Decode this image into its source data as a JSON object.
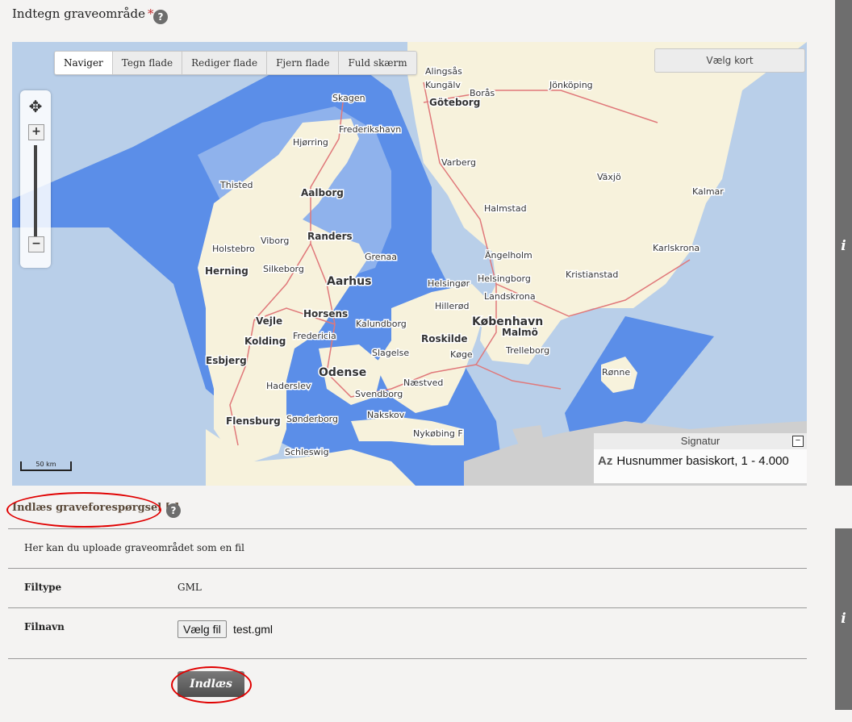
{
  "header": {
    "title": "Indtegn graveområde",
    "required_mark": "*",
    "help_glyph": "?"
  },
  "map": {
    "tabs": [
      "Naviger",
      "Tegn flade",
      "Rediger flade",
      "Fjern flade",
      "Fuld skærm"
    ],
    "active_tab": "Naviger",
    "choose_map_label": "Vælg kort",
    "zoom_in": "+",
    "zoom_out": "−",
    "scale_label": "50 km",
    "legend": {
      "title": "Signatur",
      "collapse": "−",
      "icon_text": "Az",
      "entry": "Husnummer basiskort, 1 - 4.000"
    },
    "places": [
      "Alingsås",
      "Kungälv",
      "Jönköping",
      "Göteborg",
      "Borås",
      "Skagen",
      "Frederikshavn",
      "Hjørring",
      "Varberg",
      "Växjö",
      "Kalmar",
      "Thisted",
      "Aalborg",
      "Halmstad",
      "Randers",
      "Viborg",
      "Holstebro",
      "Grenaa",
      "Karlskrona",
      "Ängelholm",
      "Herning",
      "Silkeborg",
      "Kristianstad",
      "Helsingør",
      "Helsingborg",
      "Aarhus",
      "Landskrona",
      "Hillerød",
      "Horsens",
      "København",
      "Malmö",
      "Vejle",
      "Kalundborg",
      "Fredericia",
      "Kolding",
      "Roskilde",
      "Køge",
      "Trelleborg",
      "Esbjerg",
      "Slagelse",
      "Odense",
      "Rønne",
      "Næstved",
      "Haderslev",
      "Svendborg",
      "Nakskov",
      "Sønderborg",
      "Flensburg",
      "Nykøbing F",
      "Schleswig"
    ],
    "colors": {
      "sea": "#b9cfe9",
      "shelf": "#5b8ee8",
      "land": "#f7f2dc",
      "road": "#e0787a"
    }
  },
  "upload": {
    "section_title": "Indlæs graveforespørgsel [-]",
    "help_glyph": "?",
    "description": "Her kan du uploade graveområdet som en fil",
    "filetype_label": "Filtype",
    "filetype_value": "GML",
    "filename_label": "Filnavn",
    "choose_file_label": "Vælg fil",
    "file_name": "test.gml",
    "submit_label": "Indlæs"
  },
  "sidebar": {
    "info_glyph": "i"
  },
  "annotations": {
    "ring_color": "#e00000"
  }
}
